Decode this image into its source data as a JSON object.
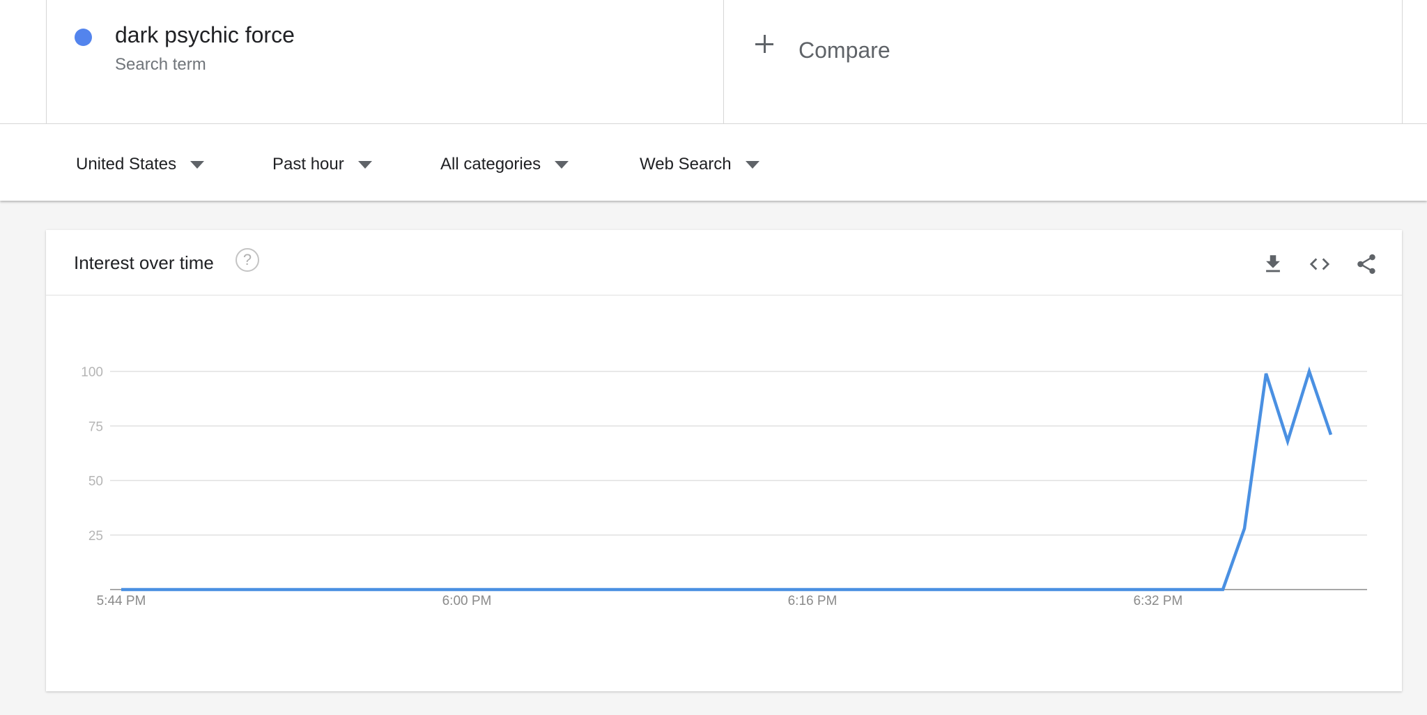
{
  "search_term": {
    "name": "dark psychic force",
    "subtitle": "Search term",
    "color": "#5384ed"
  },
  "compare": {
    "label": "Compare"
  },
  "filters": {
    "region": "United States",
    "time": "Past hour",
    "category": "All categories",
    "property": "Web Search"
  },
  "card": {
    "title": "Interest over time",
    "help_icon": "help-circle-icon",
    "actions": [
      "download-icon",
      "embed-code-icon",
      "share-icon"
    ]
  },
  "chart_data": {
    "type": "line",
    "xlabel": "",
    "ylabel": "",
    "ylim": [
      0,
      100
    ],
    "yticks": [
      100,
      75,
      50,
      25
    ],
    "x_tick_labels": [
      "5:44 PM",
      "6:00 PM",
      "6:16 PM",
      "6:32 PM"
    ],
    "x_tick_minutes": [
      0,
      16,
      32,
      48
    ],
    "xlim_minutes": [
      0,
      57.5
    ],
    "grid": true,
    "legend": "none",
    "color": "#4a90e2",
    "series": [
      {
        "minutes": [
          0,
          1,
          2,
          3,
          4,
          5,
          6,
          7,
          8,
          9,
          10,
          11,
          12,
          13,
          14,
          15,
          16,
          17,
          18,
          19,
          20,
          21,
          22,
          23,
          24,
          25,
          26,
          27,
          28,
          29,
          30,
          31,
          32,
          33,
          34,
          35,
          36,
          37,
          38,
          39,
          40,
          41,
          42,
          43,
          44,
          45,
          46,
          47,
          48,
          49,
          50,
          51,
          52,
          53,
          54,
          55,
          56
        ],
        "values": [
          0,
          0,
          0,
          0,
          0,
          0,
          0,
          0,
          0,
          0,
          0,
          0,
          0,
          0,
          0,
          0,
          0,
          0,
          0,
          0,
          0,
          0,
          0,
          0,
          0,
          0,
          0,
          0,
          0,
          0,
          0,
          0,
          0,
          0,
          0,
          0,
          0,
          0,
          0,
          0,
          0,
          0,
          0,
          0,
          0,
          0,
          0,
          0,
          0,
          0,
          0,
          0,
          28,
          99,
          68,
          100,
          71
        ]
      }
    ]
  }
}
